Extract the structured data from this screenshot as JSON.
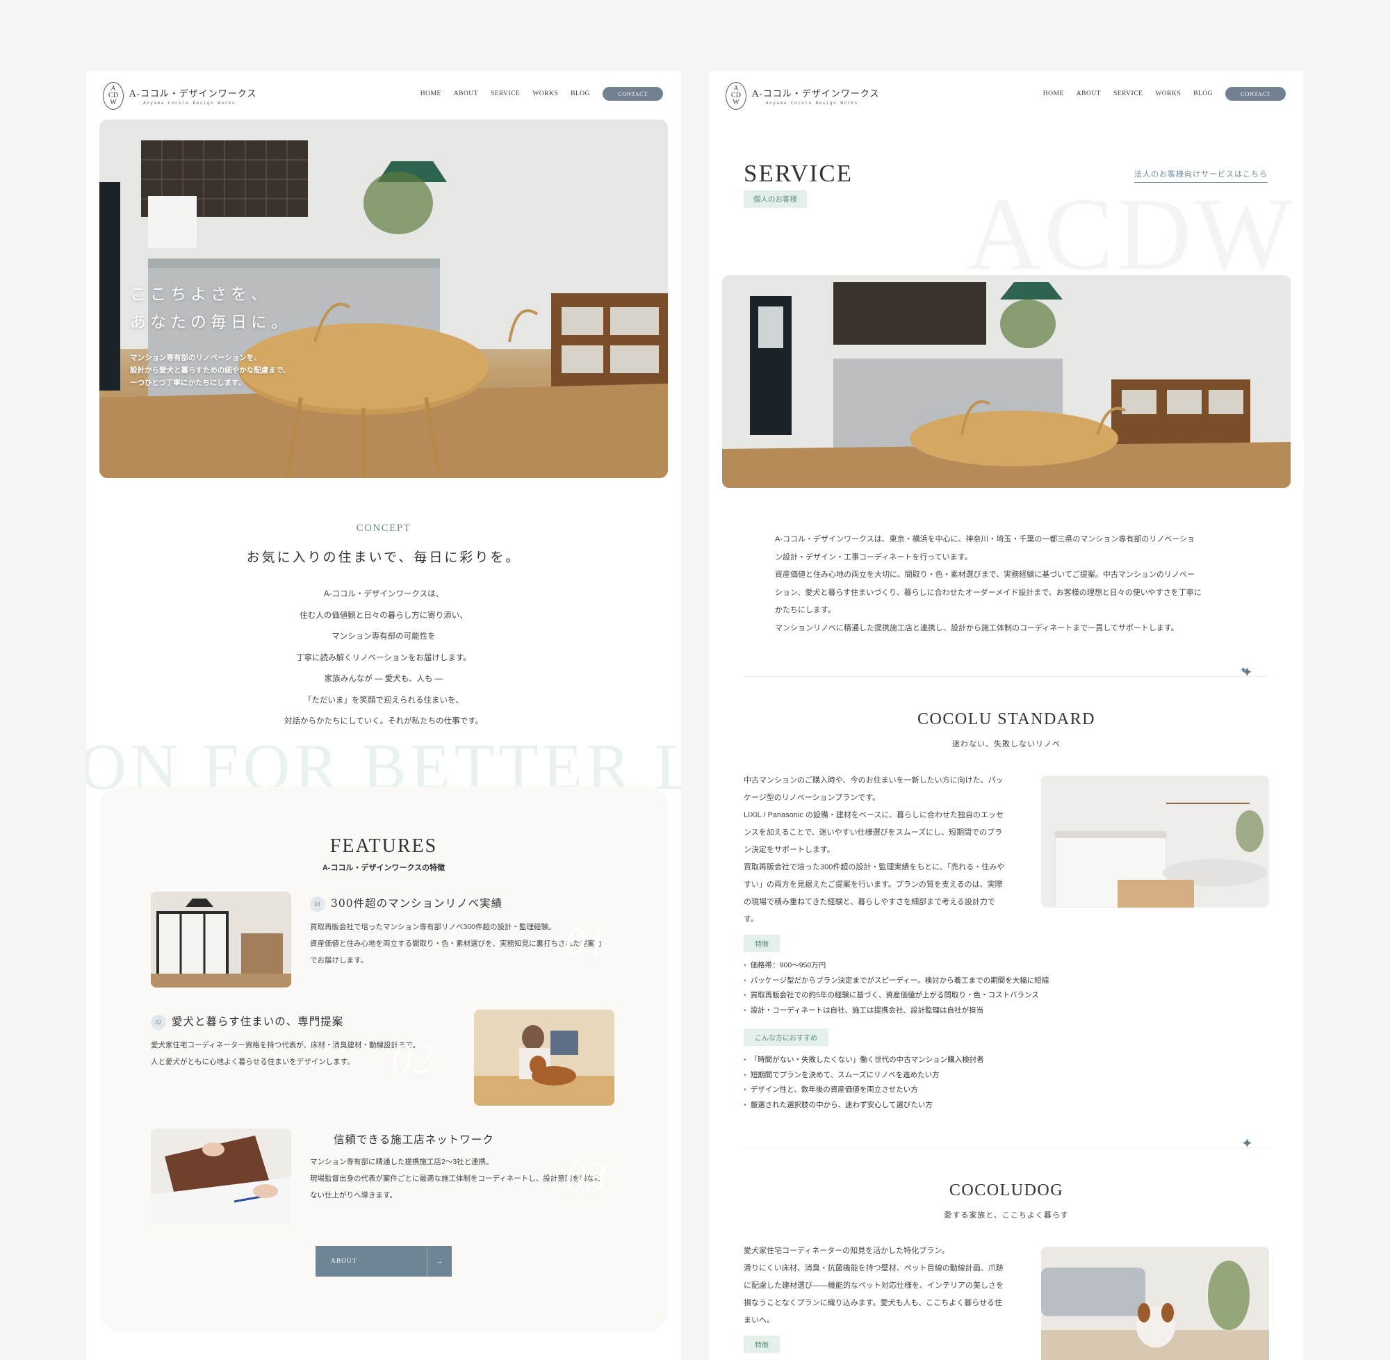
{
  "site": {
    "logo_mark": "A\nCD\nW",
    "logo_name": "A-ココル・デザインワークス",
    "logo_sub": "Aoyama Cocolu Design Works",
    "nav": [
      "HOME",
      "ABOUT",
      "SERVICE",
      "WORKS",
      "BLOG"
    ],
    "contact": "CONTACT"
  },
  "colors": {
    "accent": "#718191",
    "tag_bg": "#e3efe9",
    "tag_text": "#5f8c7e",
    "features_bg": "#faf9f6"
  },
  "top_page": {
    "hero": {
      "title_line1": "ここちよさを、",
      "title_line2": "あなたの毎日に。",
      "text_line1": "マンション専有部のリノベーションを、",
      "text_line2": "設計から愛犬と暮らすための細やかな配慮まで、",
      "text_line3": "一つひとつ丁寧にかたちにします。"
    },
    "concept": {
      "label": "CONCEPT",
      "title": "お気に入りの住まいで、毎日に彩りを。",
      "lines": [
        "A-ココル・デザインワークスは、",
        "住む人の価値観と日々の暮らし方に寄り添い、",
        "マンション専有部の可能性を",
        "丁寧に読み解くリノベーションをお届けします。",
        "家族みんなが ― 愛犬も、人も ―",
        "「ただいま」を笑顔で迎えられる住まいを、",
        "対話からかたちにしていく。それが私たちの仕事です。"
      ]
    },
    "background_band": "ON FOR BETTER LI",
    "features": {
      "title": "FEATURES",
      "subtitle": "A-ココル・デザインワークスの特徴",
      "items": [
        {
          "num": "01",
          "title": "300件超のマンションリノベ実績",
          "text_line1": "買取再販会社で培ったマンション専有部リノベ300件超の設計・監理経験。",
          "text_line2": "資産価値と住み心地を両立する間取り・色・素材選びを、実務知見に裏打ちされた提案力",
          "text_line3": "でお届けします。",
          "ghost": "01"
        },
        {
          "num": "02",
          "title": "愛犬と暮らす住まいの、専門提案",
          "text_line1": "愛犬家住宅コーディネーター資格を持つ代表が、床材・消臭建材・動線設計まで。",
          "text_line2": "人と愛犬がともに心地よく暮らせる住まいをデザインします。",
          "ghost": "02"
        },
        {
          "num": "03",
          "title": "信頼できる施工店ネットワーク",
          "text_line1": "マンション専有部に精通した提携施工店2〜3社と連携。",
          "text_line2": "現場監督出身の代表が案件ごとに最適な施工体制をコーディネートし、設計意図を損なわ",
          "text_line3": "ない仕上がりへ導きます。",
          "ghost": "03"
        }
      ],
      "button": "ABOUT",
      "button_arrow": "→"
    }
  },
  "service_page": {
    "title": "SERVICE",
    "tag": "個人のお客様",
    "corporate_link": "法人のお客様向けサービスはこちら",
    "watermark": "ACDW",
    "intro": [
      "A-ココル・デザインワークスは、東京・横浜を中心に、神奈川・埼玉・千葉の一都三県のマンション専有部のリノベーショ",
      "ン設計・デザイン・工事コーディネートを行っています。",
      "資産価値と住み心地の両立を大切に、間取り・色・素材選びまで、実務経験に基づいてご提案。中古マンションのリノベー",
      "ション、愛犬と暮らす住まいづくり、暮らしに合わせたオーダーメイド設計まで、お客様の理想と日々の使いやすさを丁寧に",
      "かたちにします。",
      "マンションリノベに精通した提携施工店と連携し、設計から施工体制のコーディネートまで一貫してサポートします。"
    ],
    "sparkle": "✦",
    "plans": [
      {
        "title": "COCOLU STANDARD",
        "subtitle": "迷わない、失敗しないリノベ",
        "text": [
          "中古マンションのご購入時や、今のお住まいを一新したい方に向けた、パッ",
          "ケージ型のリノベーションプランです。",
          "LIXIL / Panasonic の設備・建材をベースに、暮らしに合わせた独自のエッセ",
          "ンスを加えることで、迷いやすい仕様選びをスムーズにし、短期間でのプラ",
          "ン決定をサポートします。",
          "買取再販会社で培った300件超の設計・監理実績をもとに、「売れる・住みや",
          "すい」の両方を見据えたご提案を行います。プランの質を支えるのは、実際",
          "の現場で積み重ねてきた経験と、暮らしやすさを細部まで考える設計力で",
          "す。"
        ],
        "feature_tag": "特徴",
        "features": [
          "価格帯：900〜950万円",
          "パッケージ型だからプラン決定までがスピーディー。検討から着工までの期間を大幅に短縮",
          "買取再販会社での約5年の経験に基づく、資産価値が上がる間取り・色・コストバランス",
          "設計・コーディネートは自社、施工は提携会社、設計監理は自社が担当"
        ],
        "recommend_tag": "こんな方におすすめ",
        "recommend": [
          "「時間がない・失敗したくない」働く世代の中古マンション購入検討者",
          "短期間でプランを決めて、スムーズにリノベを進めたい方",
          "デザイン性と、数年後の資産価値を両立させたい方",
          "厳選された選択肢の中から、迷わず安心して選びたい方"
        ]
      },
      {
        "title": "COCOLUDOG",
        "subtitle": "愛する家族と、ここちよく暮らす",
        "text": [
          "愛犬家住宅コーディネーターの知見を活かした特化プラン。",
          "滑りにくい床材、消臭・抗菌機能を持つ壁材、ペット目線の動線計画、爪跡",
          "に配慮した建材選び――機能的なペット対応仕様を、インテリアの美しさを",
          "損なうことなくプランに織り込みます。愛犬も人も、ここちよく暮らせる住",
          "まいへ。"
        ],
        "feature_tag": "特徴"
      }
    ]
  }
}
